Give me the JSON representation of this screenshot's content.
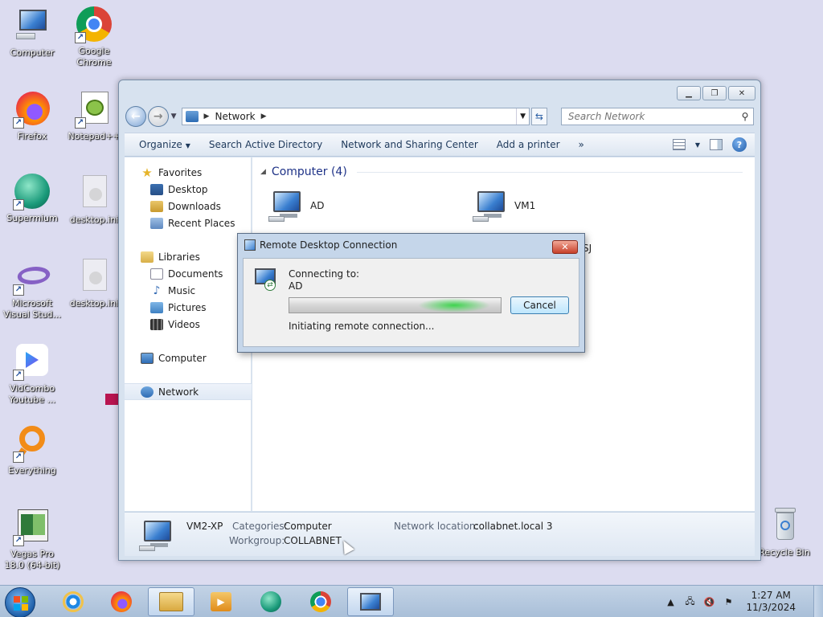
{
  "desktop": {
    "icons": [
      {
        "label": "Computer",
        "icon": "computer-icon"
      },
      {
        "label": "Google Chrome",
        "icon": "chrome-icon"
      },
      {
        "label": "Firefox",
        "icon": "firefox-icon"
      },
      {
        "label": "Notepad++",
        "icon": "notepadpp-icon"
      },
      {
        "label": "Supermium",
        "icon": "supermium-icon"
      },
      {
        "label": "desktop.ini",
        "icon": "ini-file-icon"
      },
      {
        "label": "Microsoft Visual Stud...",
        "icon": "visual-studio-icon"
      },
      {
        "label": "desktop.ini",
        "icon": "ini-file-icon"
      },
      {
        "label": "VidCombo Youtube ...",
        "icon": "vidcombo-icon"
      },
      {
        "label": "Everything",
        "icon": "everything-icon"
      },
      {
        "label": "Vegas Pro 18.0 (64-bit)",
        "icon": "vegas-icon"
      },
      {
        "label": "Recycle Bin",
        "icon": "recycle-bin-icon"
      }
    ]
  },
  "explorer": {
    "address": {
      "location": "Network"
    },
    "search": {
      "placeholder": "Search Network"
    },
    "toolbar": {
      "organize": "Organize",
      "search_ad": "Search Active Directory",
      "network_center": "Network and Sharing Center",
      "add_printer": "Add a printer",
      "more": "»"
    },
    "nav": {
      "favorites": {
        "label": "Favorites",
        "items": [
          "Desktop",
          "Downloads",
          "Recent Places"
        ]
      },
      "libraries": {
        "label": "Libraries",
        "items": [
          "Documents",
          "Music",
          "Pictures",
          "Videos"
        ]
      },
      "computer": "Computer",
      "network": "Network"
    },
    "content": {
      "group_header": "Computer (4)",
      "items": [
        "AD",
        "VM1"
      ],
      "partial_item": "SJ"
    },
    "details": {
      "name": "VM2-XP",
      "categories_label": "Categories:",
      "categories_value": "Computer",
      "workgroup_label": "Workgroup:",
      "workgroup_value": "COLLABNET",
      "netloc_label": "Network location:",
      "netloc_value": "collabnet.local 3"
    }
  },
  "rdp": {
    "title": "Remote Desktop Connection",
    "connecting_label": "Connecting to:",
    "target": "AD",
    "status": "Initiating remote connection...",
    "cancel": "Cancel",
    "progress_fraction": 0.78,
    "progress_color": "#3ed44e"
  },
  "taskbar": {
    "pinned": [
      "ie-icon",
      "firefox-icon",
      "explorer-folder-icon",
      "media-player-icon",
      "supermium-icon",
      "chrome-icon",
      "remote-desktop-icon"
    ],
    "clock": {
      "time": "1:27 AM",
      "date": "11/3/2024"
    }
  }
}
